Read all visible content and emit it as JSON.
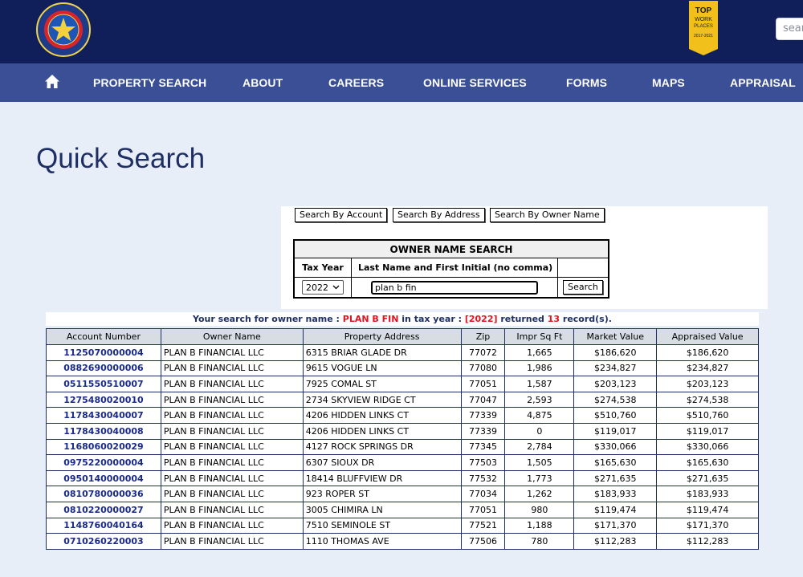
{
  "header": {
    "logo_alt": "Harris County Appraisal District Texas",
    "award": {
      "line1": "TOP",
      "line2": "WORK",
      "line3": "PLACES",
      "line4": "2017-2021"
    },
    "search_placeholder": "sear"
  },
  "nav": {
    "items": [
      {
        "label": "PROPERTY SEARCH"
      },
      {
        "label": "ABOUT"
      },
      {
        "label": "CAREERS"
      },
      {
        "label": "ONLINE SERVICES"
      },
      {
        "label": "FORMS"
      },
      {
        "label": "MAPS"
      },
      {
        "label": "APPRAISAL"
      }
    ]
  },
  "page_title": "Quick Search",
  "search_tabs": {
    "by_account": "Search By Account",
    "by_address": "Search By Address",
    "by_owner": "Search By Owner Name"
  },
  "owner_search": {
    "title": "OWNER NAME SEARCH",
    "tax_year_label": "Tax Year",
    "name_label": "Last Name and First Initial (no comma)",
    "tax_year_value": "2022",
    "name_value": "plan b fin",
    "search_button": "Search"
  },
  "result_message": {
    "prefix": "Your search for owner name : ",
    "owner": "PLAN B FIN",
    "middle": " in tax year : ",
    "year": "[2022]",
    "returned": " returned ",
    "count": "13",
    "suffix": " record(s)."
  },
  "results": {
    "columns": [
      "Account Number",
      "Owner Name",
      "Property Address",
      "Zip",
      "Impr Sq Ft",
      "Market Value",
      "Appraised Value"
    ],
    "rows": [
      [
        "1125070000004",
        "PLAN B FINANCIAL LLC",
        "6315 BRIAR GLADE DR",
        "77072",
        "1,665",
        "$186,620",
        "$186,620"
      ],
      [
        "0882690000006",
        "PLAN B FINANCIAL LLC",
        "9615 VOGUE LN",
        "77080",
        "1,986",
        "$234,827",
        "$234,827"
      ],
      [
        "0511550510007",
        "PLAN B FINANCIAL LLC",
        "7925 COMAL ST",
        "77051",
        "1,587",
        "$203,123",
        "$203,123"
      ],
      [
        "1275480020010",
        "PLAN B FINANCIAL LLC",
        "2734 SKYVIEW RIDGE CT",
        "77047",
        "2,593",
        "$274,538",
        "$274,538"
      ],
      [
        "1178430040007",
        "PLAN B FINANCIAL LLC",
        "4206 HIDDEN LINKS CT",
        "77339",
        "4,875",
        "$510,760",
        "$510,760"
      ],
      [
        "1178430040008",
        "PLAN B FINANCIAL LLC",
        "4206 HIDDEN LINKS CT",
        "77339",
        "0",
        "$119,017",
        "$119,017"
      ],
      [
        "1168060020029",
        "PLAN B FINANCIAL LLC",
        "4127 ROCK SPRINGS DR",
        "77345",
        "2,784",
        "$330,066",
        "$330,066"
      ],
      [
        "0975220000004",
        "PLAN B FINANCIAL LLC",
        "6307 SIOUX DR",
        "77503",
        "1,505",
        "$165,630",
        "$165,630"
      ],
      [
        "0950140000004",
        "PLAN B FINANCIAL LLC",
        "18414 BLUFFVIEW DR",
        "77532",
        "1,773",
        "$271,635",
        "$271,635"
      ],
      [
        "0810780000036",
        "PLAN B FINANCIAL LLC",
        "923 ROPER ST",
        "77034",
        "1,262",
        "$183,933",
        "$183,933"
      ],
      [
        "0810220000027",
        "PLAN B FINANCIAL LLC",
        "3005 CHIMIRA LN",
        "77051",
        "980",
        "$119,474",
        "$119,474"
      ],
      [
        "1148760040164",
        "PLAN B FINANCIAL LLC",
        "7510 SEMINOLE ST",
        "77521",
        "1,188",
        "$171,370",
        "$171,370"
      ],
      [
        "0710260220003",
        "PLAN B FINANCIAL LLC",
        "1110 THOMAS AVE",
        "77506",
        "780",
        "$112,283",
        "$112,283"
      ]
    ]
  }
}
